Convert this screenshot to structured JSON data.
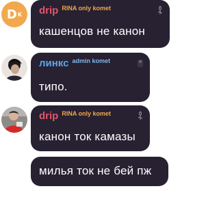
{
  "colors": {
    "bubble_bg": "#272132",
    "name_drip": "#e0566b",
    "tag_drip": "#f2a64a",
    "name_links": "#5ba6ea",
    "tag_links": "#7fb6ee",
    "avatar_letter_bg": "#f2a94e"
  },
  "messages": [
    {
      "avatar_letter": "D",
      "avatar_sup": "K",
      "name": "drip",
      "tag": "RINA only komet",
      "text": "кашенцов не канон"
    },
    {
      "name": "линкс",
      "tag": "admin komet",
      "text": "типо."
    },
    {
      "name": "drip",
      "tag": "RINA only komet",
      "text": "канон ток камазы"
    },
    {
      "text": "милья ток не бей пж"
    }
  ]
}
